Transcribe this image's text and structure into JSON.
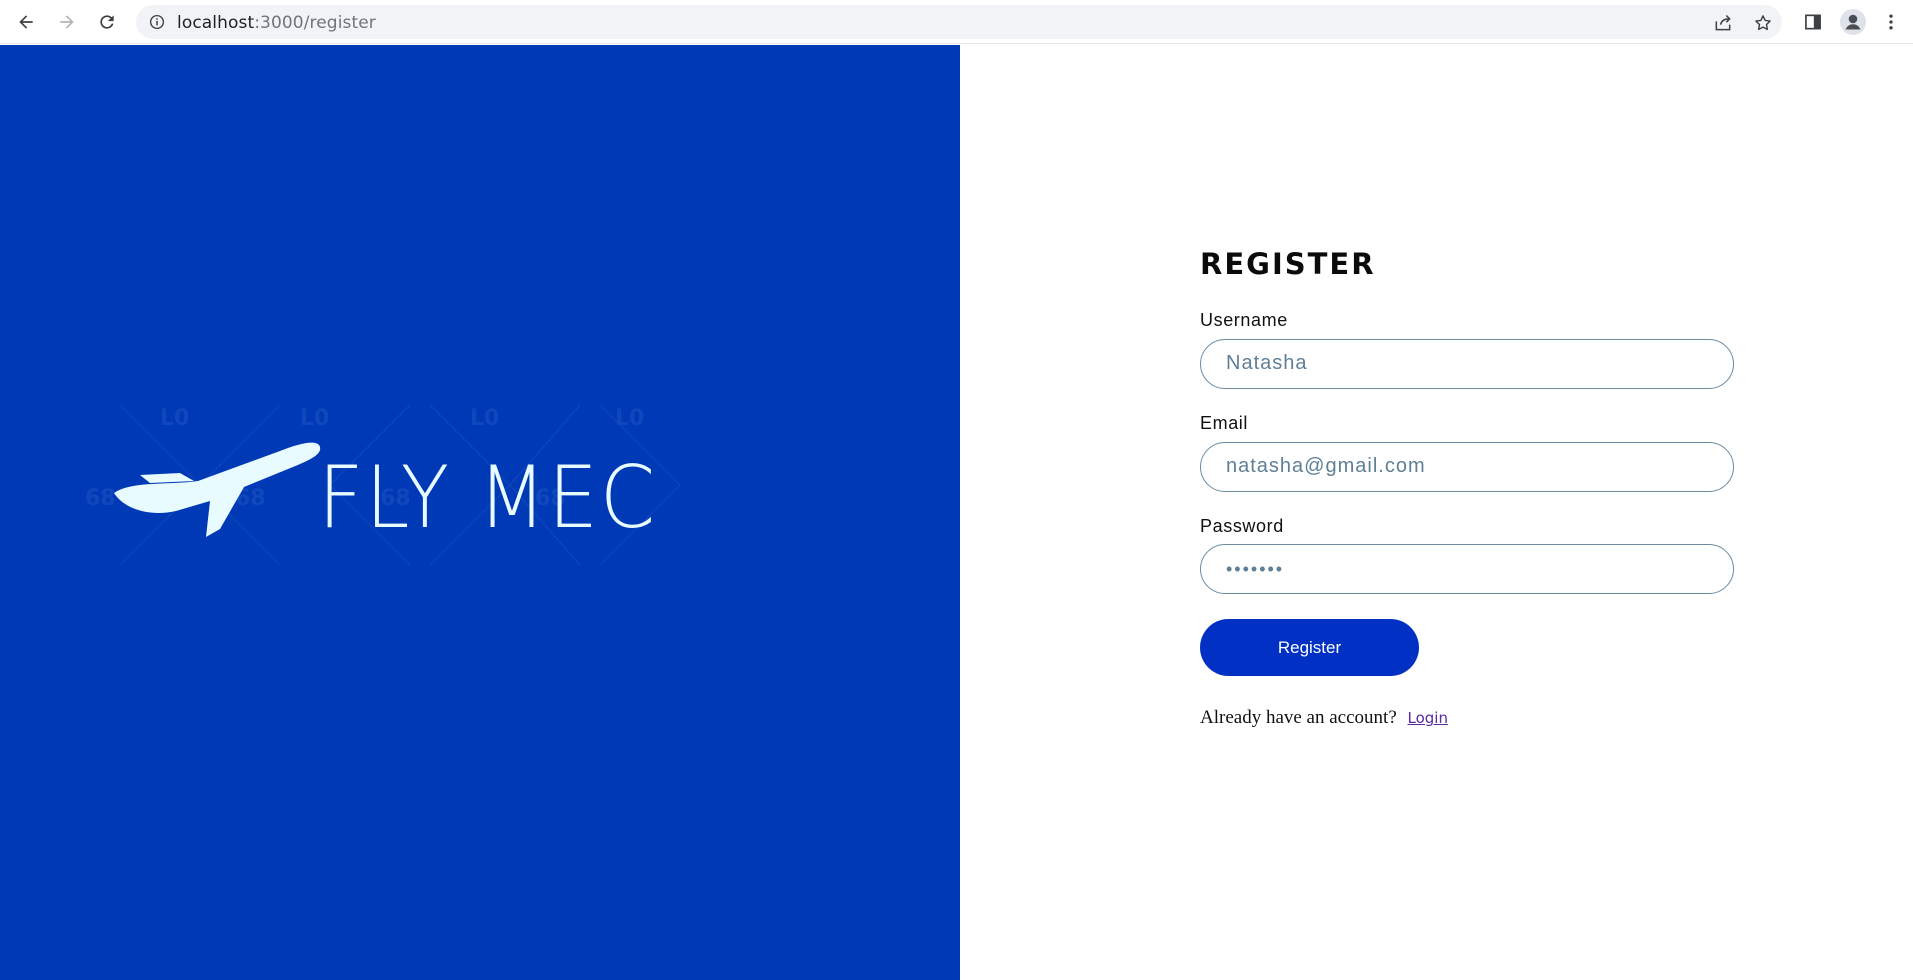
{
  "browser": {
    "url_host": "localhost",
    "url_path": ":3000/register",
    "icons": {
      "back": "arrow-left-icon",
      "forward": "arrow-right-icon",
      "reload": "reload-icon",
      "site_info": "info-icon",
      "share": "share-icon",
      "bookmark": "star-icon",
      "side_panel": "side-panel-icon",
      "profile": "profile-icon",
      "menu": "kebab-menu-icon"
    }
  },
  "brand": {
    "name": "FLY MEC",
    "panel_color": "#0039b5",
    "logo_color": "#e8fbff"
  },
  "form": {
    "title": "REGISTER",
    "username": {
      "label": "Username",
      "value": "Natasha"
    },
    "email": {
      "label": "Email",
      "value": "natasha@gmail.com"
    },
    "password": {
      "label": "Password",
      "value": "•••••••"
    },
    "submit_label": "Register",
    "submit_color": "#0030c4",
    "login_prompt": "Already have an account?",
    "login_link": "Login"
  }
}
